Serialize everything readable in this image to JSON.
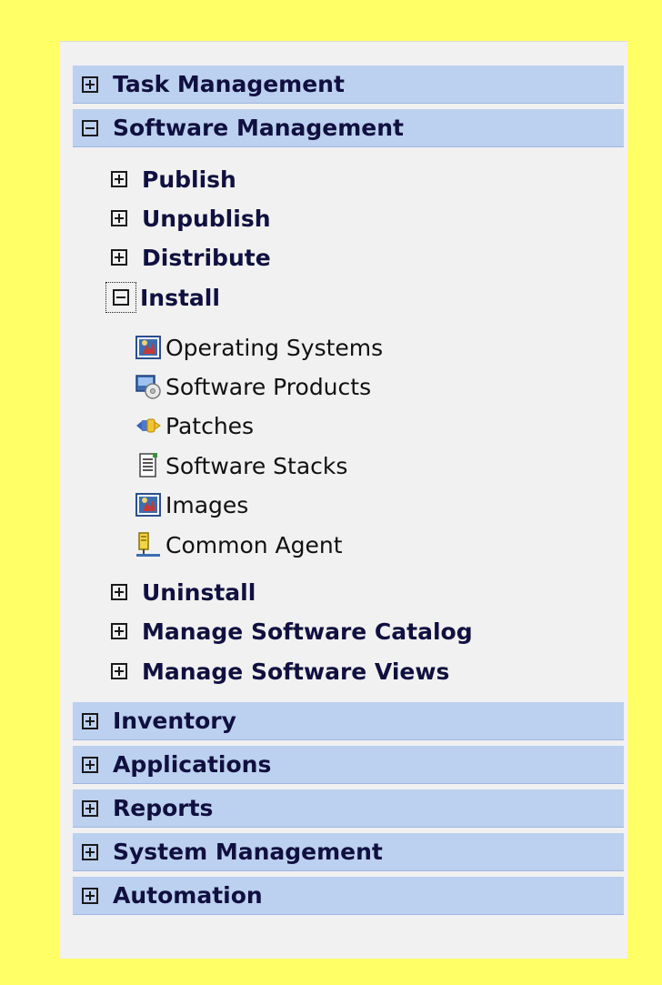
{
  "nav": {
    "top_categories": [
      {
        "label": "Task Management",
        "state": "collapsed"
      },
      {
        "label": "Software Management",
        "state": "expanded"
      }
    ],
    "software_management_items": [
      {
        "label": "Publish",
        "state": "collapsed"
      },
      {
        "label": "Unpublish",
        "state": "collapsed"
      },
      {
        "label": "Distribute",
        "state": "collapsed"
      },
      {
        "label": "Install",
        "state": "expanded",
        "focused": true
      }
    ],
    "install_leaves": [
      {
        "label": "Operating Systems",
        "icon": "operating-system-icon"
      },
      {
        "label": "Software Products",
        "icon": "software-product-icon"
      },
      {
        "label": "Patches",
        "icon": "patch-icon"
      },
      {
        "label": "Software Stacks",
        "icon": "software-stack-icon"
      },
      {
        "label": "Images",
        "icon": "image-icon"
      },
      {
        "label": "Common Agent",
        "icon": "common-agent-icon"
      }
    ],
    "software_management_items_after": [
      {
        "label": "Uninstall",
        "state": "collapsed"
      },
      {
        "label": "Manage Software Catalog",
        "state": "collapsed"
      },
      {
        "label": "Manage Software Views",
        "state": "collapsed"
      }
    ],
    "bottom_categories": [
      {
        "label": "Inventory",
        "state": "collapsed"
      },
      {
        "label": "Applications",
        "state": "collapsed"
      },
      {
        "label": "Reports",
        "state": "collapsed"
      },
      {
        "label": "System Management",
        "state": "collapsed"
      },
      {
        "label": "Automation",
        "state": "collapsed"
      }
    ]
  },
  "colors": {
    "page_background": "#ffff66",
    "panel_background": "#f1f1f1",
    "category_background": "#bcd0ef",
    "label_text": "#101040"
  }
}
